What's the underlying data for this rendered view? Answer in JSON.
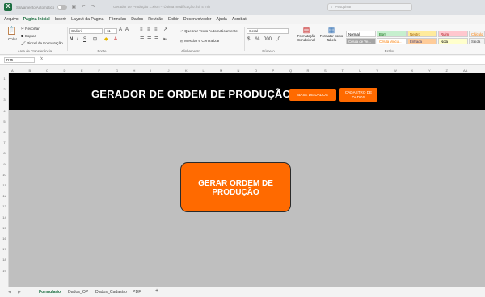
{
  "titlebar": {
    "autosave_label": "Salvamento Automático",
    "document_title": "Gerador de Produção 1.xlsm – Última modificação: há 4 min",
    "search_placeholder": "Pesquisar"
  },
  "menu": [
    "Arquivo",
    "Página Inicial",
    "Inserir",
    "Layout da Página",
    "Fórmulas",
    "Dados",
    "Revisão",
    "Exibir",
    "Desenvolvedor",
    "Ajuda",
    "Acrobat"
  ],
  "ribbon": {
    "clipboard": {
      "paste": "Colar",
      "cut": "Recortar",
      "copy": "Copiar",
      "painter": "Pincel de Formatação",
      "label": "Área de Transferência"
    },
    "font": {
      "name": "Calibri",
      "size": "11",
      "label": "Fonte"
    },
    "alignment": {
      "wrap": "Quebrar Texto Automaticamente",
      "merge": "Mesclar e Centralizar",
      "label": "Alinhamento"
    },
    "number": {
      "format": "Geral",
      "label": "Número"
    },
    "styles": {
      "conditional": "Formatação Condicional",
      "table": "Formatar como Tabela",
      "items": [
        {
          "name": "Normal",
          "bg": "#ffffff",
          "fg": "#000000"
        },
        {
          "name": "Bom",
          "bg": "#c6efce",
          "fg": "#006100"
        },
        {
          "name": "Neutro",
          "bg": "#ffeb9c",
          "fg": "#9c5700"
        },
        {
          "name": "Ruim",
          "bg": "#ffc7ce",
          "fg": "#9c0006"
        },
        {
          "name": "Cálculo",
          "bg": "#f2f2f2",
          "fg": "#fa7d00"
        },
        {
          "name": "Célula de Ve...",
          "bg": "#a5a5a5",
          "fg": "#ffffff"
        },
        {
          "name": "Célula Vincu...",
          "bg": "#ffffff",
          "fg": "#fa7d00"
        },
        {
          "name": "Entrada",
          "bg": "#ffcc99",
          "fg": "#3f3f76"
        },
        {
          "name": "Nota",
          "bg": "#ffffcc",
          "fg": "#000000"
        },
        {
          "name": "Saída",
          "bg": "#f2f2f2",
          "fg": "#3f3f3f"
        }
      ],
      "label": "Estilos"
    }
  },
  "formula_bar": {
    "name_box": "D15",
    "fx": "fx"
  },
  "columns": [
    "A",
    "B",
    "C",
    "D",
    "E",
    "F",
    "G",
    "H",
    "I",
    "J",
    "K",
    "L",
    "M",
    "N",
    "O",
    "P",
    "Q",
    "R",
    "S",
    "T",
    "U",
    "V",
    "W",
    "X",
    "Y",
    "Z",
    "AA",
    "AB"
  ],
  "rows": [
    "1",
    "2",
    "3",
    "4",
    "5",
    "6",
    "7",
    "8",
    "9",
    "10",
    "11",
    "12",
    "13",
    "14",
    "15",
    "16",
    "17",
    "18",
    "19"
  ],
  "sheet": {
    "title": "GERADOR DE ORDEM DE PRODUÇÃO",
    "btn_base": "BASE DE DADOS",
    "btn_cadastro": "CADASTRO DE DADOS",
    "btn_gerar": "GERAR ORDEM DE PRODUÇÃO"
  },
  "tabs": [
    "Formulario",
    "Dados_OP",
    "Dados_Cadastro",
    "PDF"
  ],
  "active_tab": "Formulario",
  "colors": {
    "accent": "#ff6a00",
    "excel_green": "#1d6f42",
    "banner": "#000000",
    "sheet_bg": "#bfbfbf"
  }
}
